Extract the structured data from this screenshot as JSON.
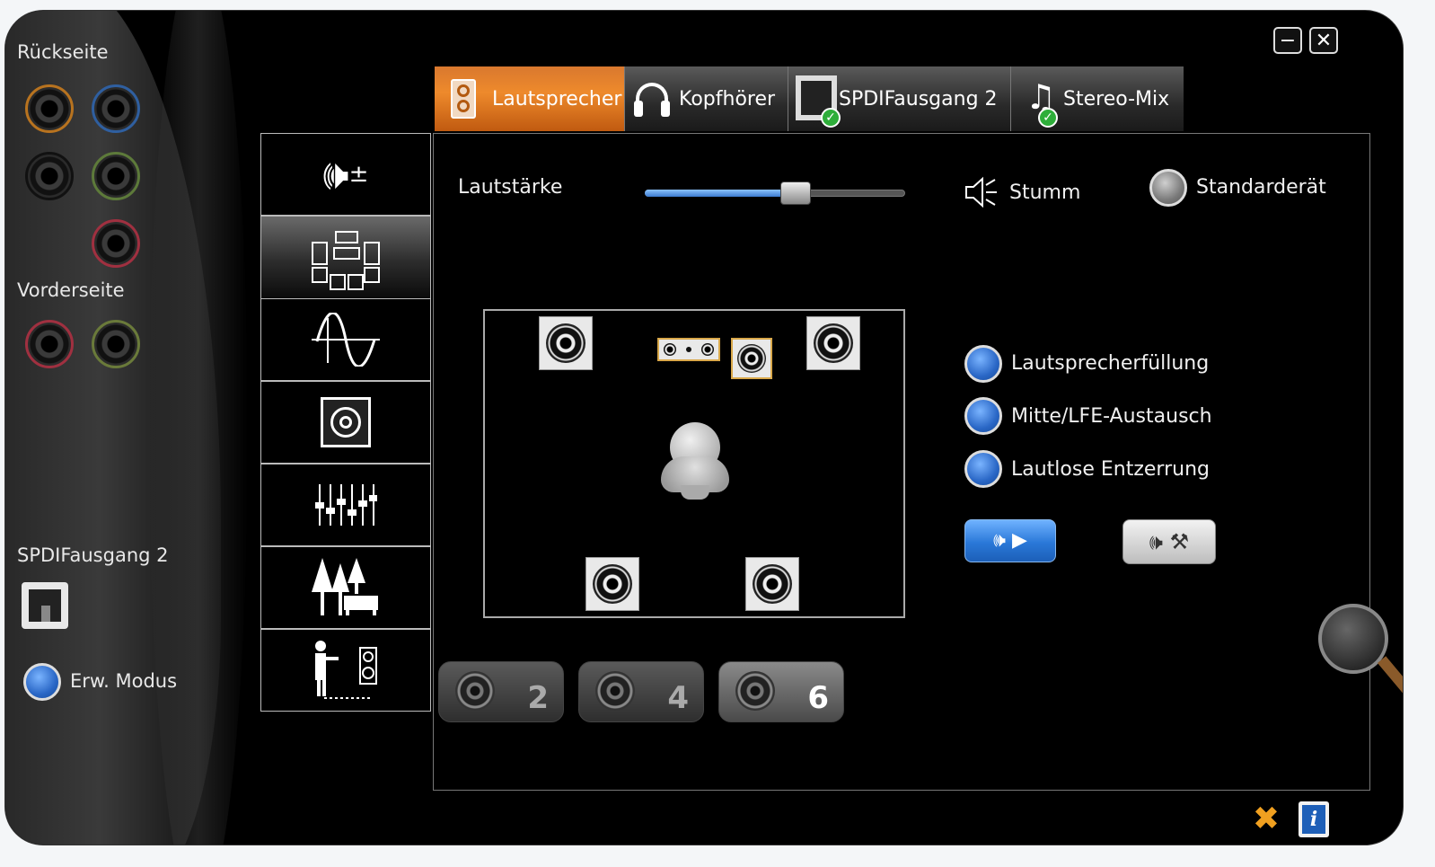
{
  "window": {
    "minimize_label": "−",
    "close_label": "✕"
  },
  "sidebar": {
    "rear_label": "Rückseite",
    "front_label": "Vorderseite",
    "spdif_label": "SPDIFausgang 2",
    "advanced_mode_label": "Erw. Modus",
    "rear_jack_colors": [
      "#b8731f",
      "#2f5fa0",
      "#111111",
      "#5d7a3a",
      "#a03040"
    ],
    "front_jack_colors": [
      "#a03040",
      "#6a7a3a"
    ]
  },
  "tabs": [
    {
      "label": "Lautsprecher",
      "icon": "speaker-icon",
      "active": true
    },
    {
      "label": "Kopfhörer",
      "icon": "headphones-icon",
      "active": false
    },
    {
      "label": "SPDIFausgang 2",
      "icon": "spdif-port-icon",
      "active": false
    },
    {
      "label": "Stereo-Mix",
      "icon": "music-note-icon",
      "active": false
    }
  ],
  "side_menu": [
    {
      "icon": "volume-adjust-icon",
      "active": false
    },
    {
      "icon": "speaker-configuration-icon",
      "active": true
    },
    {
      "icon": "sine-wave-icon",
      "active": false
    },
    {
      "icon": "subwoofer-icon",
      "active": false
    },
    {
      "icon": "equalizer-icon",
      "active": false
    },
    {
      "icon": "environment-icon",
      "active": false
    },
    {
      "icon": "room-correction-icon",
      "active": false
    }
  ],
  "main": {
    "volume_label": "Lautstärke",
    "volume_level": 0.58,
    "mute_label": "Stumm",
    "default_device_label": "Standarderät",
    "options": [
      {
        "label": "Lautsprecherfüllung"
      },
      {
        "label": "Mitte/LFE-Austausch"
      },
      {
        "label": "Lautlose Entzerrung"
      }
    ],
    "channel_buttons": [
      {
        "label": "2",
        "active": false
      },
      {
        "label": "4",
        "active": false
      },
      {
        "label": "6",
        "active": true
      }
    ]
  },
  "colors": {
    "active_tab": "#ee8a2c",
    "radio_blue": "#2a67c6",
    "background": "#000000"
  }
}
